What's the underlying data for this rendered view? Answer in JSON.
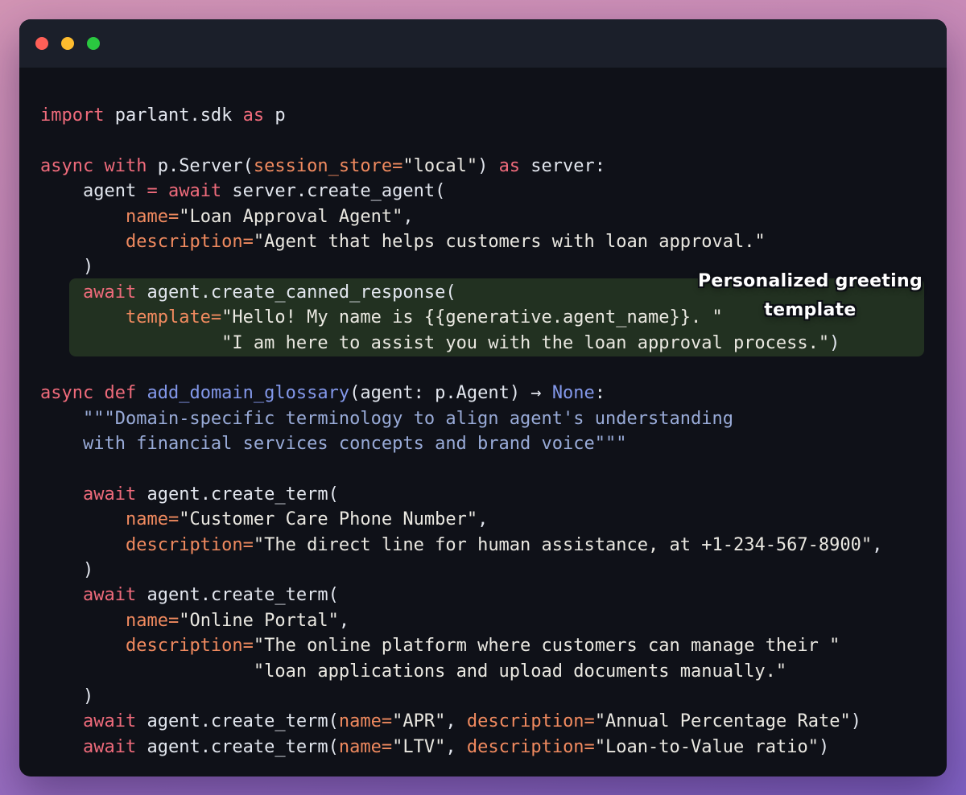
{
  "annotation": {
    "line1": "Personalized greeting",
    "line2": "template"
  },
  "colors": {
    "background_gradient": [
      "#d294b4",
      "#7f61c3"
    ],
    "window_bg": "#0f1118",
    "titlebar_bg": "#1b1f2a",
    "traffic_lights": {
      "close": "#ff5f57",
      "minimize": "#febc2e",
      "zoom": "#2ac840"
    },
    "highlight_bg": "#223121",
    "syntax": {
      "keyword": "#ef6b7b",
      "param": "#f08a5f",
      "string": "#eae8e1",
      "function": "#8398ea",
      "docstring": "#99abd8",
      "plain": "#e2e6ee"
    },
    "annotation_text": "#ffffff"
  },
  "code": {
    "lines": [
      {
        "hl": false,
        "tokens": [
          [
            "k",
            "import"
          ],
          [
            "p",
            " parlant.sdk "
          ],
          [
            "k",
            "as"
          ],
          [
            "p",
            " p"
          ]
        ]
      },
      {
        "hl": false,
        "tokens": []
      },
      {
        "hl": false,
        "tokens": [
          [
            "k",
            "async with"
          ],
          [
            "p",
            " p.Server("
          ],
          [
            "o",
            "session_store="
          ],
          [
            "s",
            "\"local\""
          ],
          [
            "p",
            ") "
          ],
          [
            "k",
            "as"
          ],
          [
            "p",
            " server:"
          ]
        ]
      },
      {
        "hl": false,
        "tokens": [
          [
            "p",
            "    agent "
          ],
          [
            "k",
            "="
          ],
          [
            "p",
            " "
          ],
          [
            "k",
            "await"
          ],
          [
            "p",
            " server.create_agent("
          ]
        ]
      },
      {
        "hl": false,
        "tokens": [
          [
            "p",
            "        "
          ],
          [
            "o",
            "name="
          ],
          [
            "s",
            "\"Loan Approval Agent\""
          ],
          [
            "p",
            ","
          ]
        ]
      },
      {
        "hl": false,
        "tokens": [
          [
            "p",
            "        "
          ],
          [
            "o",
            "description="
          ],
          [
            "s",
            "\"Agent that helps customers with loan approval.\""
          ]
        ]
      },
      {
        "hl": false,
        "tokens": [
          [
            "p",
            "    )"
          ]
        ]
      },
      {
        "hl": true,
        "tokens": [
          [
            "p",
            "    "
          ],
          [
            "k",
            "await"
          ],
          [
            "p",
            " agent.create_canned_response("
          ]
        ]
      },
      {
        "hl": true,
        "tokens": [
          [
            "p",
            "        "
          ],
          [
            "o",
            "template="
          ],
          [
            "s",
            "\"Hello! My name is {{generative.agent_name}}. \""
          ]
        ]
      },
      {
        "hl": true,
        "tokens": [
          [
            "p",
            "                 "
          ],
          [
            "s",
            "\"I am here to assist you with the loan approval process.\""
          ],
          [
            "p",
            ")"
          ]
        ]
      },
      {
        "hl": false,
        "tokens": []
      },
      {
        "hl": false,
        "tokens": [
          [
            "k",
            "async def"
          ],
          [
            "p",
            " "
          ],
          [
            "b",
            "add_domain_glossary"
          ],
          [
            "p",
            "(agent: p.Agent) → "
          ],
          [
            "b",
            "None"
          ],
          [
            "p",
            ":"
          ]
        ]
      },
      {
        "hl": false,
        "tokens": [
          [
            "p",
            "    "
          ],
          [
            "d",
            "\"\"\"Domain-specific terminology to align agent's understanding"
          ]
        ]
      },
      {
        "hl": false,
        "tokens": [
          [
            "d",
            "    with financial services concepts and brand voice\"\"\""
          ]
        ]
      },
      {
        "hl": false,
        "tokens": []
      },
      {
        "hl": false,
        "tokens": [
          [
            "p",
            "    "
          ],
          [
            "k",
            "await"
          ],
          [
            "p",
            " agent.create_term("
          ]
        ]
      },
      {
        "hl": false,
        "tokens": [
          [
            "p",
            "        "
          ],
          [
            "o",
            "name="
          ],
          [
            "s",
            "\"Customer Care Phone Number\""
          ],
          [
            "p",
            ","
          ]
        ]
      },
      {
        "hl": false,
        "tokens": [
          [
            "p",
            "        "
          ],
          [
            "o",
            "description="
          ],
          [
            "s",
            "\"The direct line for human assistance, at +1-234-567-8900\""
          ],
          [
            "p",
            ","
          ]
        ]
      },
      {
        "hl": false,
        "tokens": [
          [
            "p",
            "    )"
          ]
        ]
      },
      {
        "hl": false,
        "tokens": [
          [
            "p",
            "    "
          ],
          [
            "k",
            "await"
          ],
          [
            "p",
            " agent.create_term("
          ]
        ]
      },
      {
        "hl": false,
        "tokens": [
          [
            "p",
            "        "
          ],
          [
            "o",
            "name="
          ],
          [
            "s",
            "\"Online Portal\""
          ],
          [
            "p",
            ","
          ]
        ]
      },
      {
        "hl": false,
        "tokens": [
          [
            "p",
            "        "
          ],
          [
            "o",
            "description="
          ],
          [
            "s",
            "\"The online platform where customers can manage their \""
          ]
        ]
      },
      {
        "hl": false,
        "tokens": [
          [
            "p",
            "                    "
          ],
          [
            "s",
            "\"loan applications and upload documents manually.\""
          ]
        ]
      },
      {
        "hl": false,
        "tokens": [
          [
            "p",
            "    )"
          ]
        ]
      },
      {
        "hl": false,
        "tokens": [
          [
            "p",
            "    "
          ],
          [
            "k",
            "await"
          ],
          [
            "p",
            " agent.create_term("
          ],
          [
            "o",
            "name="
          ],
          [
            "s",
            "\"APR\""
          ],
          [
            "p",
            ", "
          ],
          [
            "o",
            "description="
          ],
          [
            "s",
            "\"Annual Percentage Rate\""
          ],
          [
            "p",
            ")"
          ]
        ]
      },
      {
        "hl": false,
        "tokens": [
          [
            "p",
            "    "
          ],
          [
            "k",
            "await"
          ],
          [
            "p",
            " agent.create_term("
          ],
          [
            "o",
            "name="
          ],
          [
            "s",
            "\"LTV\""
          ],
          [
            "p",
            ", "
          ],
          [
            "o",
            "description="
          ],
          [
            "s",
            "\"Loan-to-Value ratio\""
          ],
          [
            "p",
            ")"
          ]
        ]
      }
    ]
  }
}
